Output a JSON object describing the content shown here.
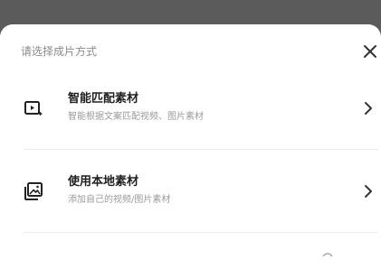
{
  "sheet": {
    "title": "请选择成片方式"
  },
  "options": [
    {
      "label": "智能匹配素材",
      "description": "智能根据文案匹配视频、图片素材",
      "icon": "smart-video-icon"
    },
    {
      "label": "使用本地素材",
      "description": "添加自己的视频/图片素材",
      "icon": "local-gallery-icon"
    }
  ],
  "colors": {
    "backdrop": "#5b5b5b",
    "sheet": "#ffffff",
    "title": "#8a8a8a",
    "label": "#1f1f1f",
    "description": "#9a9a9a",
    "divider": "#ececec"
  }
}
